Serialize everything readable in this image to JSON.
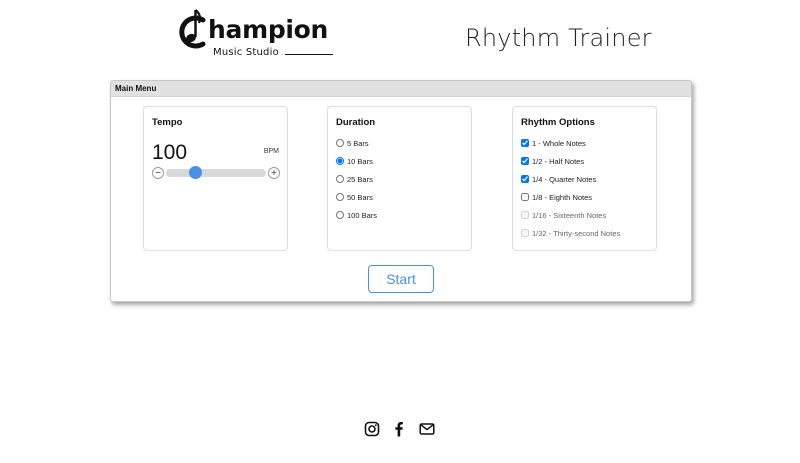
{
  "header": {
    "logo_word": "hampion",
    "logo_subtitle": "Music Studio",
    "app_title": "Rhythm Trainer"
  },
  "panel": {
    "title": "Main Menu"
  },
  "tempo": {
    "title": "Tempo",
    "value": "100",
    "unit": "BPM",
    "slider_fraction": 0.29,
    "decrement_label": "−",
    "increment_label": "+"
  },
  "duration": {
    "title": "Duration",
    "options": [
      {
        "label": "5 Bars",
        "selected": false
      },
      {
        "label": "10 Bars",
        "selected": true
      },
      {
        "label": "25 Bars",
        "selected": false
      },
      {
        "label": "50 Bars",
        "selected": false
      },
      {
        "label": "100 Bars",
        "selected": false
      }
    ]
  },
  "rhythm": {
    "title": "Rhythm Options",
    "options": [
      {
        "label": "1 - Whole Notes",
        "checked": true,
        "disabled": false
      },
      {
        "label": "1/2 - Half Notes",
        "checked": true,
        "disabled": false
      },
      {
        "label": "1/4 - Quarter Notes",
        "checked": true,
        "disabled": false
      },
      {
        "label": "1/8 - Eighth Notes",
        "checked": false,
        "disabled": false
      },
      {
        "label": "1/16 - Sixteenth Notes",
        "checked": false,
        "disabled": true
      },
      {
        "label": "1/32 - Thirty-second Notes",
        "checked": false,
        "disabled": true
      }
    ]
  },
  "start_label": "Start",
  "footer": {
    "icons": [
      "instagram-icon",
      "facebook-icon",
      "mail-icon"
    ]
  },
  "colors": {
    "accent": "#4a90e2",
    "panel_header": "#e1e1e1"
  }
}
